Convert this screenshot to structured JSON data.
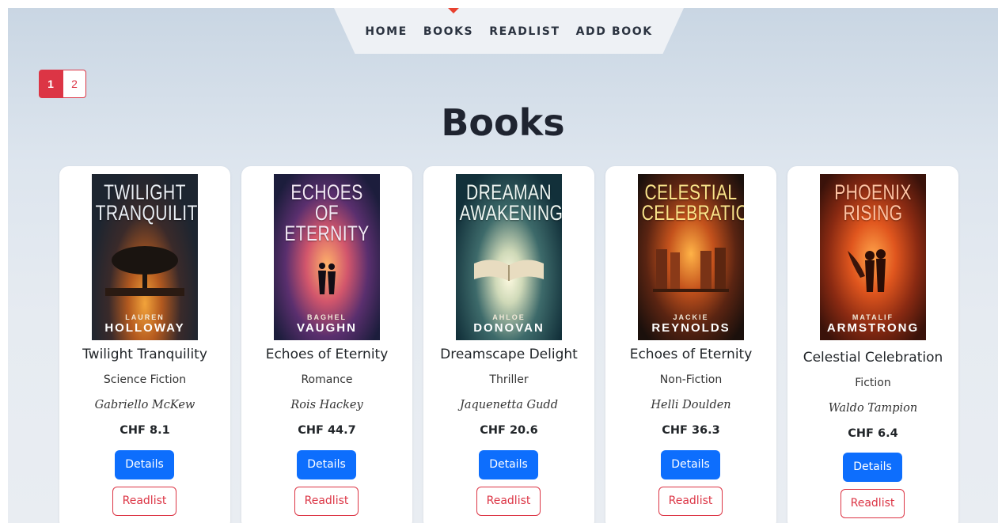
{
  "nav": {
    "items": [
      {
        "label": "HOME"
      },
      {
        "label": "BOOKS"
      },
      {
        "label": "READLIST"
      },
      {
        "label": "ADD BOOK"
      }
    ]
  },
  "pagination": {
    "pages": [
      "1",
      "2"
    ],
    "active": "1"
  },
  "page_title": "Books",
  "buttons": {
    "details": "Details",
    "readlist": "Readlist"
  },
  "books": [
    {
      "cover_title": "TWILIGHT TRANQUILITY",
      "cover_author_first": "LAUREN",
      "cover_author_last": "HOLLOWAY",
      "title": "Twilight Tranquility",
      "genre": "Science Fiction",
      "author": "Gabriello McKew",
      "price": "CHF 8.1"
    },
    {
      "cover_title": "ECHOES OF ETERNITY",
      "cover_author_first": "BAGHEL",
      "cover_author_last": "VAUGHN",
      "title": "Echoes of Eternity",
      "genre": "Romance",
      "author": "Rois Hackey",
      "price": "CHF 44.7"
    },
    {
      "cover_title": "DREAMAN AWAKENING",
      "cover_author_first": "AHLOE",
      "cover_author_last": "DONOVAN",
      "title": "Dreamscape Delight",
      "genre": "Thriller",
      "author": "Jaquenetta Gudd",
      "price": "CHF 20.6"
    },
    {
      "cover_title": "CELESTIAL CELEBRATION",
      "cover_author_first": "JACKIE",
      "cover_author_last": "REYNOLDS",
      "title": "Echoes of Eternity",
      "genre": "Non-Fiction",
      "author": "Helli Doulden",
      "price": "CHF 36.3"
    },
    {
      "cover_title": "PHOENIX RISING",
      "cover_author_first": "MATALIF",
      "cover_author_last": "ARMSTRONG",
      "title": "Celestial Celebration",
      "genre": "Fiction",
      "author": "Waldo Tampion",
      "price": "CHF 6.4"
    }
  ]
}
